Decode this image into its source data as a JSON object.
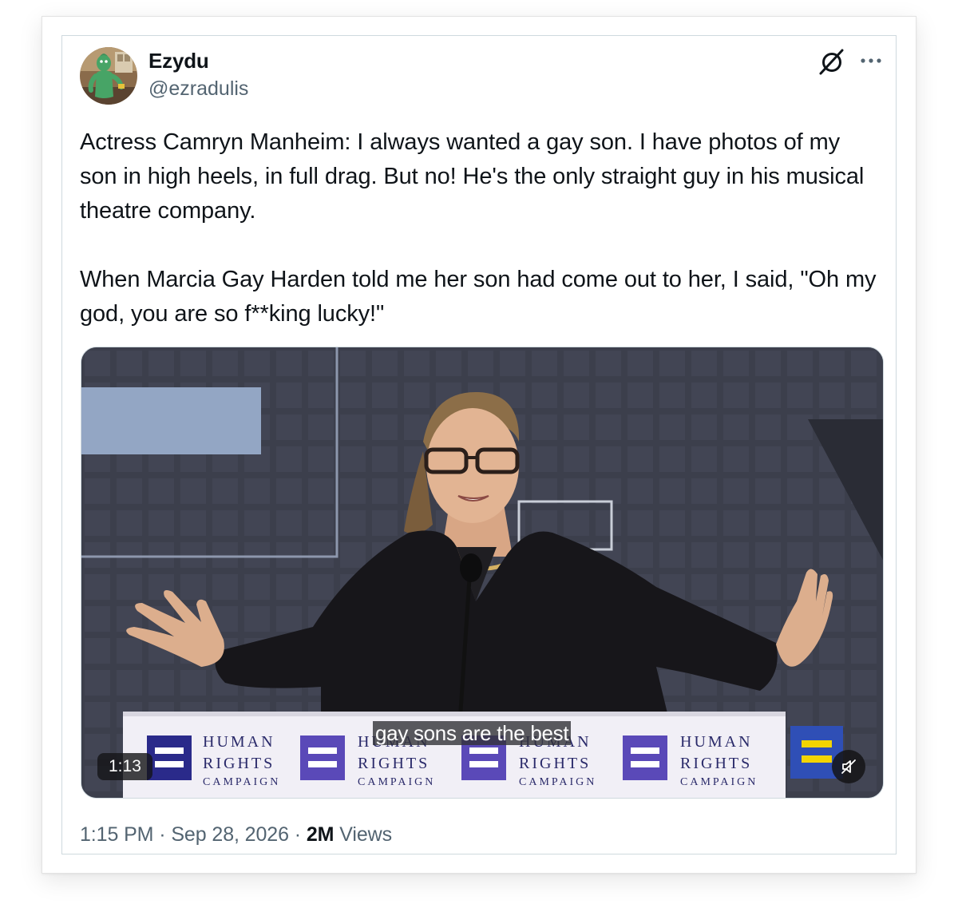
{
  "author": {
    "name": "Ezydu",
    "handle": "@ezradulis"
  },
  "tweet": {
    "paragraphs": [
      "Actress Camryn Manheim: I always wanted a gay son. I have photos of my son in high heels, in full drag. But no! He's the only straight guy in his musical theatre company.",
      "When Marcia Gay Harden told me her son had come out to her, I said, \"Oh my god, you are so f**king lucky!\""
    ]
  },
  "video": {
    "caption": "gay sons are the best",
    "duration": "1:13",
    "banner_brand": {
      "line1": "HUMAN",
      "line2": "RIGHTS",
      "line3": "CAMPAIGN"
    }
  },
  "meta": {
    "time": "1:15 PM",
    "separator": "·",
    "date": "Sep 28, 2026",
    "views_count": "2M",
    "views_label": "Views"
  },
  "icons": {
    "grok": "grok-icon",
    "more": "more-icon",
    "mute": "muted-speaker-icon"
  },
  "colors": {
    "text": "#0f1419",
    "secondary": "#536471",
    "border": "#cfd9de",
    "hrc_blue": "#2a2a8a",
    "hrc_yellow": "#f3d400"
  }
}
